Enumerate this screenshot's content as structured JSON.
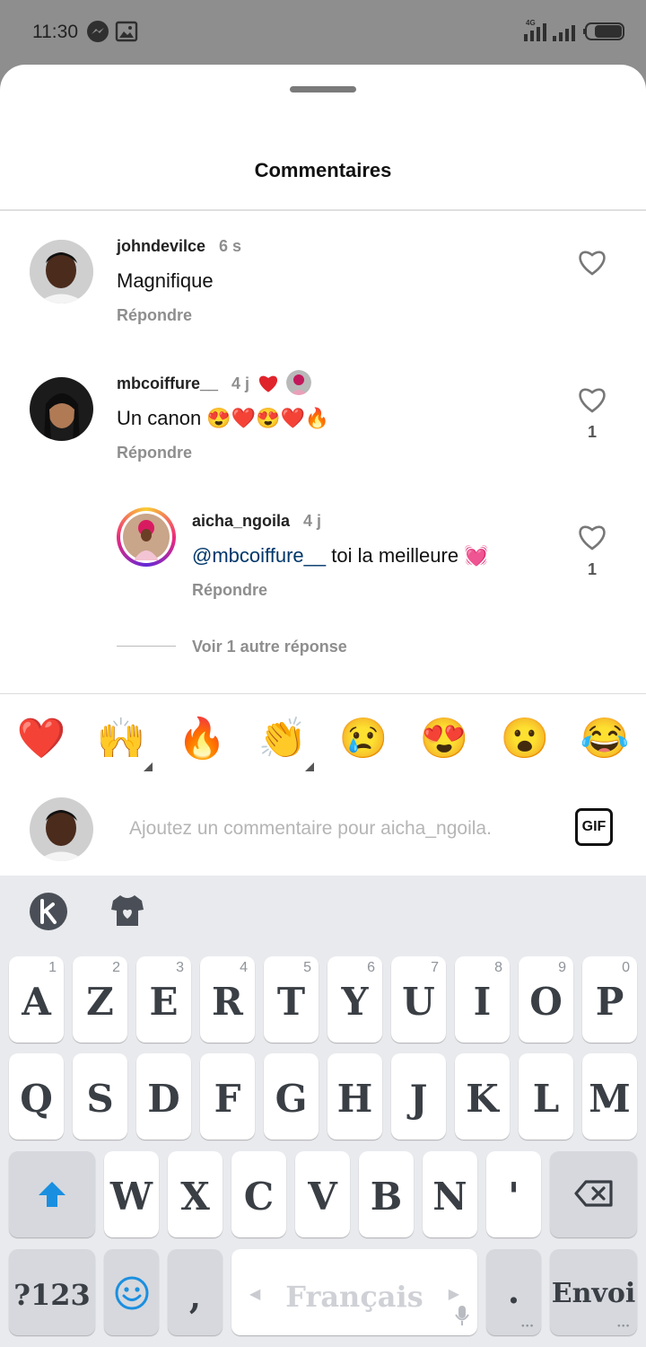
{
  "status_bar": {
    "time": "11:30",
    "network": "4G"
  },
  "header": {
    "title": "Commentaires"
  },
  "comments": [
    {
      "username": "johndevilce",
      "time": "6 s",
      "text": "Magnifique",
      "reply_label": "Répondre"
    },
    {
      "username": "mbcoiffure__",
      "time": "4 j",
      "text": "Un canon 😍❤️😍❤️🔥",
      "reply_label": "Répondre",
      "likes": "1"
    },
    {
      "username": "aicha_ngoila",
      "time": "4 j",
      "mention": "@mbcoiffure__",
      "text": " toi la meilleure 💓",
      "reply_label": "Répondre",
      "likes": "1"
    }
  ],
  "more_replies": "Voir 1 autre réponse",
  "emoji_bar": [
    "❤️",
    "🙌",
    "🔥",
    "👏",
    "😢",
    "😍",
    "😮",
    "😂"
  ],
  "composer": {
    "placeholder": "Ajoutez un commentaire pour aicha_ngoila.",
    "gif_label": "GIF"
  },
  "keyboard": {
    "row1": [
      {
        "k": "A",
        "n": "1"
      },
      {
        "k": "Z",
        "n": "2"
      },
      {
        "k": "E",
        "n": "3"
      },
      {
        "k": "R",
        "n": "4"
      },
      {
        "k": "T",
        "n": "5"
      },
      {
        "k": "Y",
        "n": "6"
      },
      {
        "k": "U",
        "n": "7"
      },
      {
        "k": "I",
        "n": "8"
      },
      {
        "k": "O",
        "n": "9"
      },
      {
        "k": "P",
        "n": "0"
      }
    ],
    "row2": [
      "Q",
      "S",
      "D",
      "F",
      "G",
      "H",
      "J",
      "K",
      "L",
      "M"
    ],
    "row3": [
      "W",
      "X",
      "C",
      "V",
      "B",
      "N",
      "'"
    ],
    "symbols_label": "?123",
    "comma": ",",
    "space_label": "Français",
    "period": ".",
    "enter_label": "Envoi"
  },
  "colors": {
    "accent_blue": "#1a8fe0",
    "mention": "#00376b",
    "heart_red": "#e0242c"
  }
}
